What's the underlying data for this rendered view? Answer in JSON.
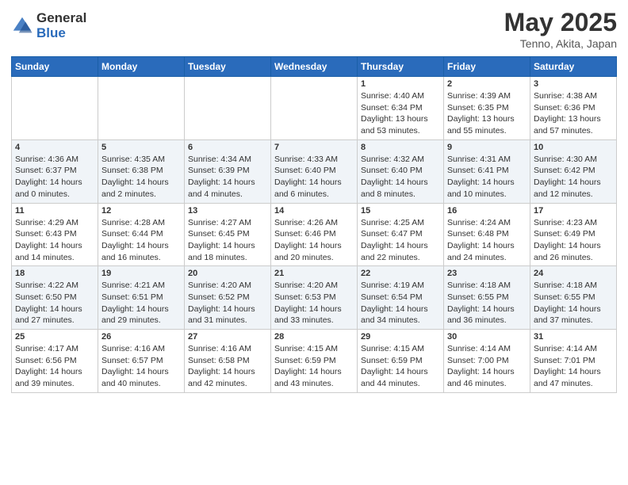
{
  "header": {
    "logo_general": "General",
    "logo_blue": "Blue",
    "month_title": "May 2025",
    "location": "Tenno, Akita, Japan"
  },
  "weekdays": [
    "Sunday",
    "Monday",
    "Tuesday",
    "Wednesday",
    "Thursday",
    "Friday",
    "Saturday"
  ],
  "weeks": [
    [
      {
        "day": "",
        "info": ""
      },
      {
        "day": "",
        "info": ""
      },
      {
        "day": "",
        "info": ""
      },
      {
        "day": "",
        "info": ""
      },
      {
        "day": "1",
        "info": "Sunrise: 4:40 AM\nSunset: 6:34 PM\nDaylight: 13 hours\nand 53 minutes."
      },
      {
        "day": "2",
        "info": "Sunrise: 4:39 AM\nSunset: 6:35 PM\nDaylight: 13 hours\nand 55 minutes."
      },
      {
        "day": "3",
        "info": "Sunrise: 4:38 AM\nSunset: 6:36 PM\nDaylight: 13 hours\nand 57 minutes."
      }
    ],
    [
      {
        "day": "4",
        "info": "Sunrise: 4:36 AM\nSunset: 6:37 PM\nDaylight: 14 hours\nand 0 minutes."
      },
      {
        "day": "5",
        "info": "Sunrise: 4:35 AM\nSunset: 6:38 PM\nDaylight: 14 hours\nand 2 minutes."
      },
      {
        "day": "6",
        "info": "Sunrise: 4:34 AM\nSunset: 6:39 PM\nDaylight: 14 hours\nand 4 minutes."
      },
      {
        "day": "7",
        "info": "Sunrise: 4:33 AM\nSunset: 6:40 PM\nDaylight: 14 hours\nand 6 minutes."
      },
      {
        "day": "8",
        "info": "Sunrise: 4:32 AM\nSunset: 6:40 PM\nDaylight: 14 hours\nand 8 minutes."
      },
      {
        "day": "9",
        "info": "Sunrise: 4:31 AM\nSunset: 6:41 PM\nDaylight: 14 hours\nand 10 minutes."
      },
      {
        "day": "10",
        "info": "Sunrise: 4:30 AM\nSunset: 6:42 PM\nDaylight: 14 hours\nand 12 minutes."
      }
    ],
    [
      {
        "day": "11",
        "info": "Sunrise: 4:29 AM\nSunset: 6:43 PM\nDaylight: 14 hours\nand 14 minutes."
      },
      {
        "day": "12",
        "info": "Sunrise: 4:28 AM\nSunset: 6:44 PM\nDaylight: 14 hours\nand 16 minutes."
      },
      {
        "day": "13",
        "info": "Sunrise: 4:27 AM\nSunset: 6:45 PM\nDaylight: 14 hours\nand 18 minutes."
      },
      {
        "day": "14",
        "info": "Sunrise: 4:26 AM\nSunset: 6:46 PM\nDaylight: 14 hours\nand 20 minutes."
      },
      {
        "day": "15",
        "info": "Sunrise: 4:25 AM\nSunset: 6:47 PM\nDaylight: 14 hours\nand 22 minutes."
      },
      {
        "day": "16",
        "info": "Sunrise: 4:24 AM\nSunset: 6:48 PM\nDaylight: 14 hours\nand 24 minutes."
      },
      {
        "day": "17",
        "info": "Sunrise: 4:23 AM\nSunset: 6:49 PM\nDaylight: 14 hours\nand 26 minutes."
      }
    ],
    [
      {
        "day": "18",
        "info": "Sunrise: 4:22 AM\nSunset: 6:50 PM\nDaylight: 14 hours\nand 27 minutes."
      },
      {
        "day": "19",
        "info": "Sunrise: 4:21 AM\nSunset: 6:51 PM\nDaylight: 14 hours\nand 29 minutes."
      },
      {
        "day": "20",
        "info": "Sunrise: 4:20 AM\nSunset: 6:52 PM\nDaylight: 14 hours\nand 31 minutes."
      },
      {
        "day": "21",
        "info": "Sunrise: 4:20 AM\nSunset: 6:53 PM\nDaylight: 14 hours\nand 33 minutes."
      },
      {
        "day": "22",
        "info": "Sunrise: 4:19 AM\nSunset: 6:54 PM\nDaylight: 14 hours\nand 34 minutes."
      },
      {
        "day": "23",
        "info": "Sunrise: 4:18 AM\nSunset: 6:55 PM\nDaylight: 14 hours\nand 36 minutes."
      },
      {
        "day": "24",
        "info": "Sunrise: 4:18 AM\nSunset: 6:55 PM\nDaylight: 14 hours\nand 37 minutes."
      }
    ],
    [
      {
        "day": "25",
        "info": "Sunrise: 4:17 AM\nSunset: 6:56 PM\nDaylight: 14 hours\nand 39 minutes."
      },
      {
        "day": "26",
        "info": "Sunrise: 4:16 AM\nSunset: 6:57 PM\nDaylight: 14 hours\nand 40 minutes."
      },
      {
        "day": "27",
        "info": "Sunrise: 4:16 AM\nSunset: 6:58 PM\nDaylight: 14 hours\nand 42 minutes."
      },
      {
        "day": "28",
        "info": "Sunrise: 4:15 AM\nSunset: 6:59 PM\nDaylight: 14 hours\nand 43 minutes."
      },
      {
        "day": "29",
        "info": "Sunrise: 4:15 AM\nSunset: 6:59 PM\nDaylight: 14 hours\nand 44 minutes."
      },
      {
        "day": "30",
        "info": "Sunrise: 4:14 AM\nSunset: 7:00 PM\nDaylight: 14 hours\nand 46 minutes."
      },
      {
        "day": "31",
        "info": "Sunrise: 4:14 AM\nSunset: 7:01 PM\nDaylight: 14 hours\nand 47 minutes."
      }
    ]
  ]
}
